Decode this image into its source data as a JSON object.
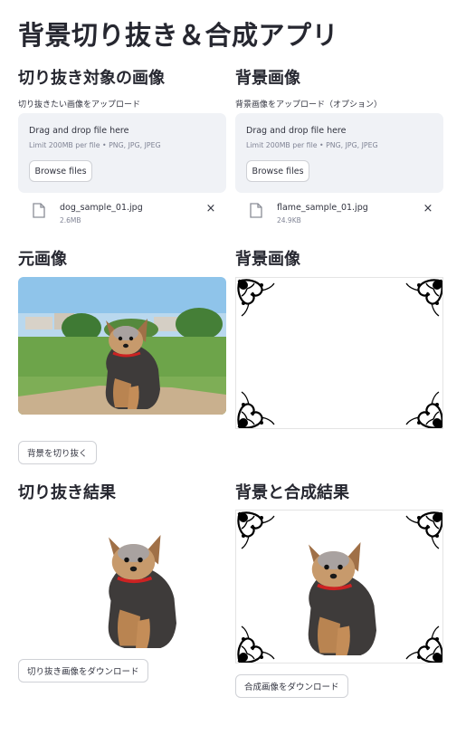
{
  "app": {
    "title": "背景切り抜き＆合成アプリ"
  },
  "uploads": {
    "subject": {
      "header": "切り抜き対象の画像",
      "label": "切り抜きたい画像をアップロード",
      "drop_text": "Drag and drop file here",
      "limit_text": "Limit 200MB per file • PNG, JPG, JPEG",
      "browse_label": "Browse files",
      "file": {
        "name": "dog_sample_01.jpg",
        "size": "2.6MB",
        "remove_icon": "×"
      }
    },
    "background": {
      "header": "背景画像",
      "label": "背景画像をアップロード（オプション）",
      "drop_text": "Drag and drop file here",
      "limit_text": "Limit 200MB per file • PNG, JPG, JPEG",
      "browse_label": "Browse files",
      "file": {
        "name": "flame_sample_01.jpg",
        "size": "24.9KB",
        "remove_icon": "×"
      }
    }
  },
  "previews": {
    "original_header": "元画像",
    "background_header": "背景画像"
  },
  "actions": {
    "cutout_label": "背景を切り抜く"
  },
  "results": {
    "cutout_header": "切り抜き結果",
    "composite_header": "背景と合成結果",
    "download_cutout_label": "切り抜き画像をダウンロード",
    "download_composite_label": "合成画像をダウンロード"
  },
  "icons": {
    "file": "file-icon",
    "close": "close-icon",
    "ornament": "corner-ornament-icon"
  },
  "colors": {
    "dropzone_bg": "#f0f2f6",
    "text": "#31333f",
    "muted": "#808495",
    "sky": "#8fc4ea",
    "grass": "#6da44a"
  }
}
